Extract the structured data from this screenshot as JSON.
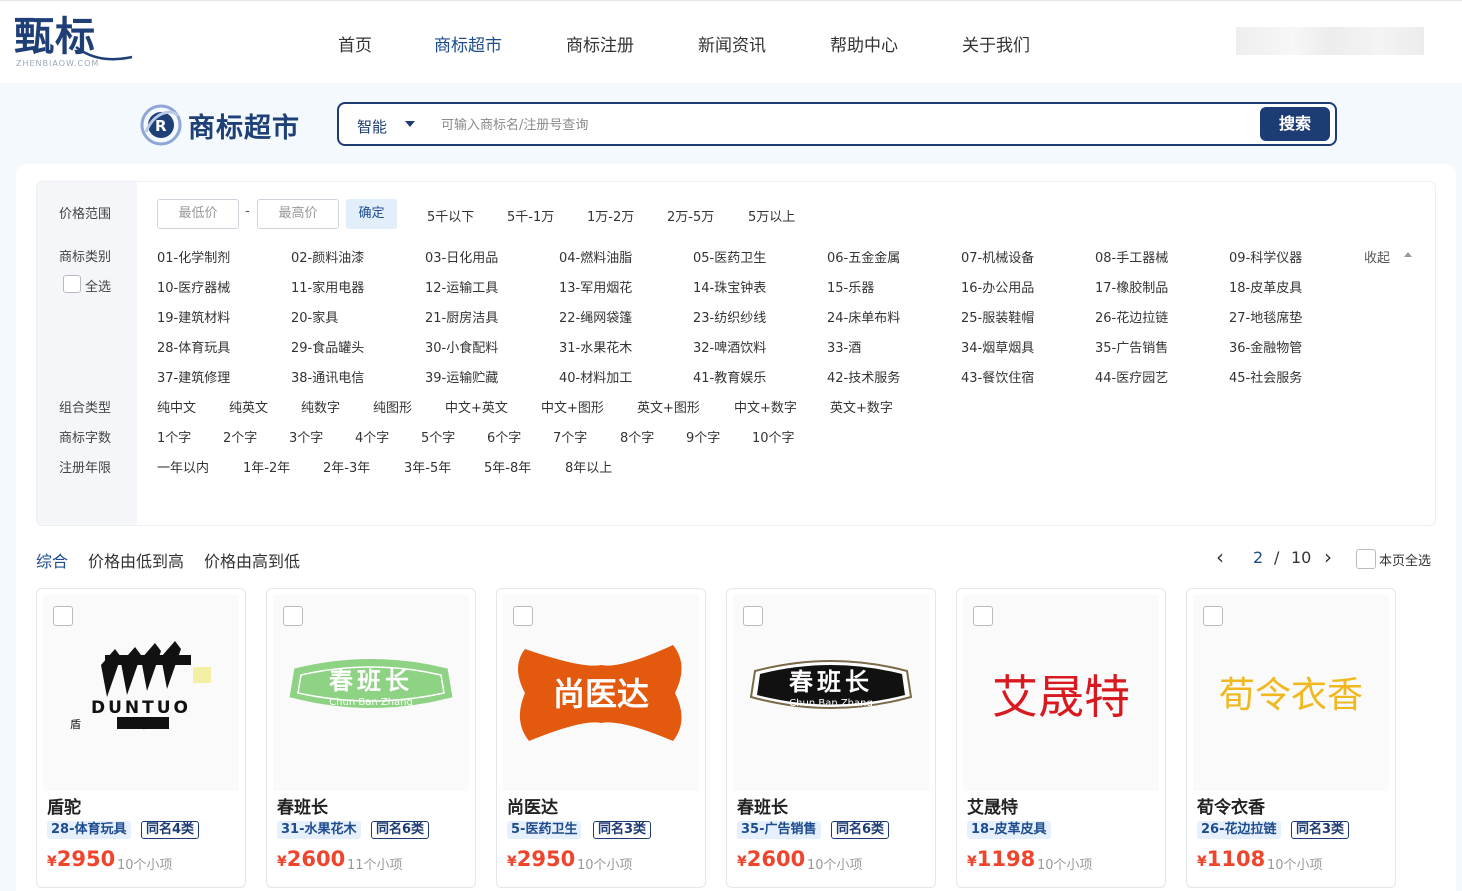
{
  "logo": {
    "cn": "甄标",
    "en": "ZHENBIAOW.COM"
  },
  "nav": [
    {
      "label": "首页"
    },
    {
      "label": "商标超市",
      "active": true
    },
    {
      "label": "商标注册"
    },
    {
      "label": "新闻资讯"
    },
    {
      "label": "帮助中心"
    },
    {
      "label": "关于我们"
    }
  ],
  "search": {
    "title": "商标超市",
    "mode": "智能",
    "placeholder": "可输入商标名/注册号查询",
    "button": "搜索"
  },
  "filters": {
    "price": {
      "label": "价格范围",
      "min_placeholder": "最低价",
      "dash": "-",
      "max_placeholder": "最高价",
      "confirm": "确定",
      "options": [
        "5千以下",
        "5千-1万",
        "1万-2万",
        "2万-5万",
        "5万以上"
      ]
    },
    "category": {
      "label": "商标类别",
      "select_all": "全选",
      "collapse": "收起",
      "rows": [
        [
          "01-化学制剂",
          "02-颜料油漆",
          "03-日化用品",
          "04-燃料油脂",
          "05-医药卫生",
          "06-五金金属",
          "07-机械设备",
          "08-手工器械",
          "09-科学仪器"
        ],
        [
          "10-医疗器械",
          "11-家用电器",
          "12-运输工具",
          "13-军用烟花",
          "14-珠宝钟表",
          "15-乐器",
          "16-办公用品",
          "17-橡胶制品",
          "18-皮革皮具"
        ],
        [
          "19-建筑材料",
          "20-家具",
          "21-厨房洁具",
          "22-绳网袋篷",
          "23-纺织纱线",
          "24-床单布料",
          "25-服装鞋帽",
          "26-花边拉链",
          "27-地毯席垫"
        ],
        [
          "28-体育玩具",
          "29-食品罐头",
          "30-小食配料",
          "31-水果花木",
          "32-啤酒饮料",
          "33-酒",
          "34-烟草烟具",
          "35-广告销售",
          "36-金融物管"
        ],
        [
          "37-建筑修理",
          "38-通讯电信",
          "39-运输贮藏",
          "40-材料加工",
          "41-教育娱乐",
          "42-技术服务",
          "43-餐饮住宿",
          "44-医疗园艺",
          "45-社会服务"
        ]
      ]
    },
    "combo": {
      "label": "组合类型",
      "options": [
        "纯中文",
        "纯英文",
        "纯数字",
        "纯图形",
        "中文+英文",
        "中文+图形",
        "英文+图形",
        "中文+数字",
        "英文+数字"
      ]
    },
    "length": {
      "label": "商标字数",
      "options": [
        "1个字",
        "2个字",
        "3个字",
        "4个字",
        "5个字",
        "6个字",
        "7个字",
        "8个字",
        "9个字",
        "10个字"
      ]
    },
    "years": {
      "label": "注册年限",
      "options": [
        "一年以内",
        "1年-2年",
        "2年-3年",
        "3年-5年",
        "5年-8年",
        "8年以上"
      ]
    }
  },
  "sort": {
    "options": [
      "综合",
      "价格由低到高",
      "价格由高到低"
    ],
    "active": 0
  },
  "pager": {
    "prev": "‹",
    "current": "2",
    "sep": "/",
    "total": "10",
    "next": "›",
    "select_page": "本页全选"
  },
  "colors": {
    "brand": "#1e3c74",
    "price": "#f0452d",
    "tag_bg": "#e6f0fc"
  },
  "cards": [
    {
      "name": "盾驼",
      "category": "28-体育玩具",
      "same": "同名4类",
      "currency": "¥",
      "price": "2950",
      "items": "10个小项",
      "logo": {
        "cn": "盾驼",
        "en": "DUNTUO"
      }
    },
    {
      "name": "春班长",
      "category": "31-水果花木",
      "same": "同名6类",
      "currency": "¥",
      "price": "2600",
      "items": "11个小项",
      "logo": {
        "cn": "春班长",
        "en": "Chun Ban Zhang"
      }
    },
    {
      "name": "尚医达",
      "category": "5-医药卫生",
      "same": "同名3类",
      "currency": "¥",
      "price": "2950",
      "items": "10个小项",
      "logo": {
        "cn": "尚医达"
      }
    },
    {
      "name": "春班长",
      "category": "35-广告销售",
      "same": "同名6类",
      "currency": "¥",
      "price": "2600",
      "items": "10个小项",
      "logo": {
        "cn": "春班长",
        "en": "Chun Ban Zhang"
      }
    },
    {
      "name": "艾晟特",
      "category": "18-皮革皮具",
      "currency": "¥",
      "price": "1198",
      "items": "10个小项",
      "logo": {
        "cn": "艾晟特"
      }
    },
    {
      "name": "荀令衣香",
      "category": "26-花边拉链",
      "same": "同名3类",
      "currency": "¥",
      "price": "1108",
      "items": "10个小项",
      "logo": {
        "cn": "荀令衣香"
      }
    }
  ]
}
